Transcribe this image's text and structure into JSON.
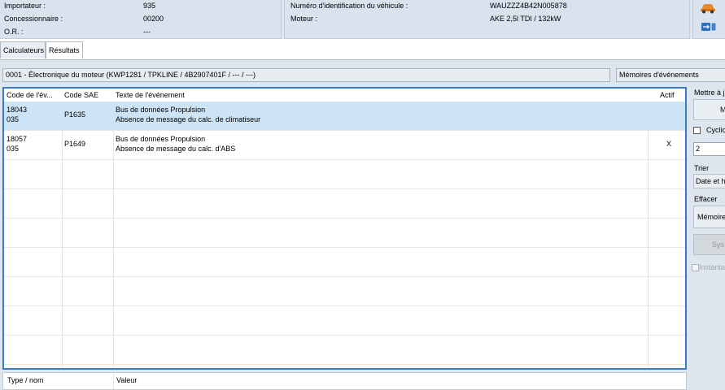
{
  "header": {
    "left": [
      {
        "label": "Importateur :",
        "value": "935"
      },
      {
        "label": "Concessionnaire :",
        "value": "00200"
      },
      {
        "label": "O.R. :",
        "value": "---"
      }
    ],
    "right": [
      {
        "label": "Numéro d'identification du véhicule :",
        "value": "WAUZZZ4B42N005878"
      },
      {
        "label": "Moteur :",
        "value": "AKE 2,5l TDI / 132kW"
      }
    ],
    "icons": [
      "car-icon",
      "usb-connection-icon"
    ]
  },
  "tabs": [
    {
      "label": "Calculateurs",
      "active": false
    },
    {
      "label": "Résultats",
      "active": true
    }
  ],
  "ecu_title": "0001 - Électronique du moteur  (KWP1281 / TPKLINE / 4B2907401F / --- / ---)",
  "memory_dropdown": "Mémoires d'événements",
  "table": {
    "columns": [
      "Code de l'év...",
      "Code SAE",
      "Texte de l'événement",
      "Actif"
    ],
    "rows": [
      {
        "code1": "18043",
        "code2": "035",
        "sae": "P1635",
        "text1": "Bus de données Propulsion",
        "text2": "Absence de message du calc. de climatiseur",
        "active": "",
        "selected": true
      },
      {
        "code1": "18057",
        "code2": "035",
        "sae": "P1649",
        "text1": "Bus de données Propulsion",
        "text2": "Absence de message du calc. d'ABS",
        "active": "X",
        "selected": false
      }
    ]
  },
  "side": {
    "update_label": "Mettre à j",
    "update_button": "M",
    "cyclic_label": "Cyclic",
    "cycle_value": "2",
    "sort_label": "Trier",
    "sort_value": "Date et h",
    "clear_label": "Effacer",
    "clear_button": "Mémoire",
    "sys_button": "Sys",
    "instant_label": "Instanta"
  },
  "bottom_table": {
    "columns": [
      "Type / nom",
      "Valeur"
    ]
  }
}
